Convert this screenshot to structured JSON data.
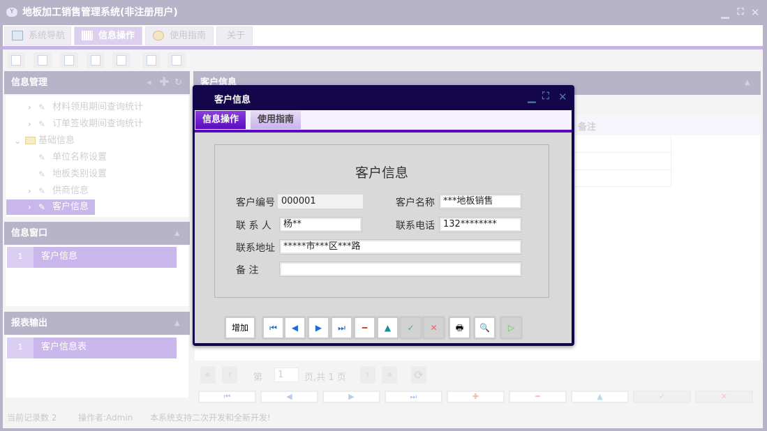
{
  "app": {
    "title": "地板加工销售管理系统(非注册用户)",
    "logo_icon": "cloud-logo-icon"
  },
  "tabs": [
    {
      "label": "系统导航",
      "icon": "monitor-icon"
    },
    {
      "label": "信息操作",
      "icon": "grid-icon",
      "active": true
    },
    {
      "label": "使用指南",
      "icon": "help-icon"
    },
    {
      "label": "关于"
    }
  ],
  "toolbar": [
    "search-icon",
    "list-icon",
    "document-icon",
    "user-icon",
    "monitor-icon",
    "export-icon",
    "window-icon"
  ],
  "left": {
    "info_mgmt": {
      "title": "信息管理",
      "tree": [
        {
          "label": "材料领用期间查询统计",
          "level": 2,
          "expandable": true
        },
        {
          "label": "订单签收期间查询统计",
          "level": 2,
          "expandable": true
        },
        {
          "label": "基础信息",
          "level": 1,
          "folder": true,
          "expanded": true
        },
        {
          "label": "单位名称设置",
          "level": 2
        },
        {
          "label": "地板类别设置",
          "level": 2
        },
        {
          "label": "供商信息",
          "level": 2,
          "expandable": true
        },
        {
          "label": "客户信息",
          "level": 2,
          "expandable": true,
          "selected": true
        }
      ]
    },
    "info_window": {
      "title": "信息窗口",
      "items": [
        {
          "num": "1",
          "label": "客户信息"
        }
      ]
    },
    "report": {
      "title": "报表输出",
      "items": [
        {
          "num": "1",
          "label": "客户信息表"
        }
      ]
    }
  },
  "main": {
    "title": "客户信息",
    "grid_header": "备注",
    "pager": {
      "page_prefix": "第",
      "page": "1",
      "page_suffix": "页,共 1 页"
    }
  },
  "status": {
    "records": "当前记录数 2",
    "operator": "操作者:Admin",
    "note": "本系统支持二次开发和全新开发!"
  },
  "modal": {
    "title": "客户信息",
    "tabs": [
      "信息操作",
      "使用指南"
    ],
    "form_title": "客户信息",
    "fields": {
      "code": {
        "label": "客户编号",
        "value": "000001"
      },
      "name": {
        "label": "客户名称",
        "value": "***地板销售"
      },
      "contact": {
        "label": "联 系 人",
        "value": "杨**"
      },
      "phone": {
        "label": "联系电话",
        "value": "132********"
      },
      "address": {
        "label": "联系地址",
        "value": "*****市***区***路"
      },
      "remark": {
        "label": "备 注",
        "value": ""
      }
    },
    "add_label": "增加"
  },
  "colors": {
    "accent": "#5a0bbf",
    "modal_title": "#13064a",
    "selected": "#c9b6ea"
  }
}
